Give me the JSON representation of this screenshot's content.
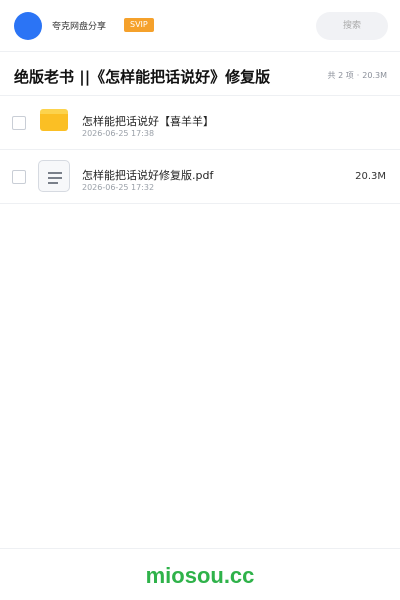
{
  "header": {
    "brand": "夸克网盘分享",
    "badge": "SVIP",
    "search_placeholder": "搜索"
  },
  "folder": {
    "title": "绝版老书 ||《怎样能把话说好》修复版",
    "count_text": "共 2 项",
    "dot": "·",
    "total_size": "20.3M"
  },
  "files": [
    {
      "name": "怎样能把话说好【喜羊羊】",
      "date": "2026-06-25 17:38",
      "size": "",
      "icon": "folder-icon"
    },
    {
      "name": "怎样能把话说好修复版.pdf",
      "date": "2026-06-25 17:32",
      "size": "20.3M",
      "icon": "document-icon"
    }
  ],
  "footer": {
    "watermark": "miosou.cc"
  },
  "colors": {
    "avatar": "#2b74f5",
    "badge": "#f5a12b",
    "folder": "#fbbf24",
    "watermark": "#2fb24a"
  }
}
